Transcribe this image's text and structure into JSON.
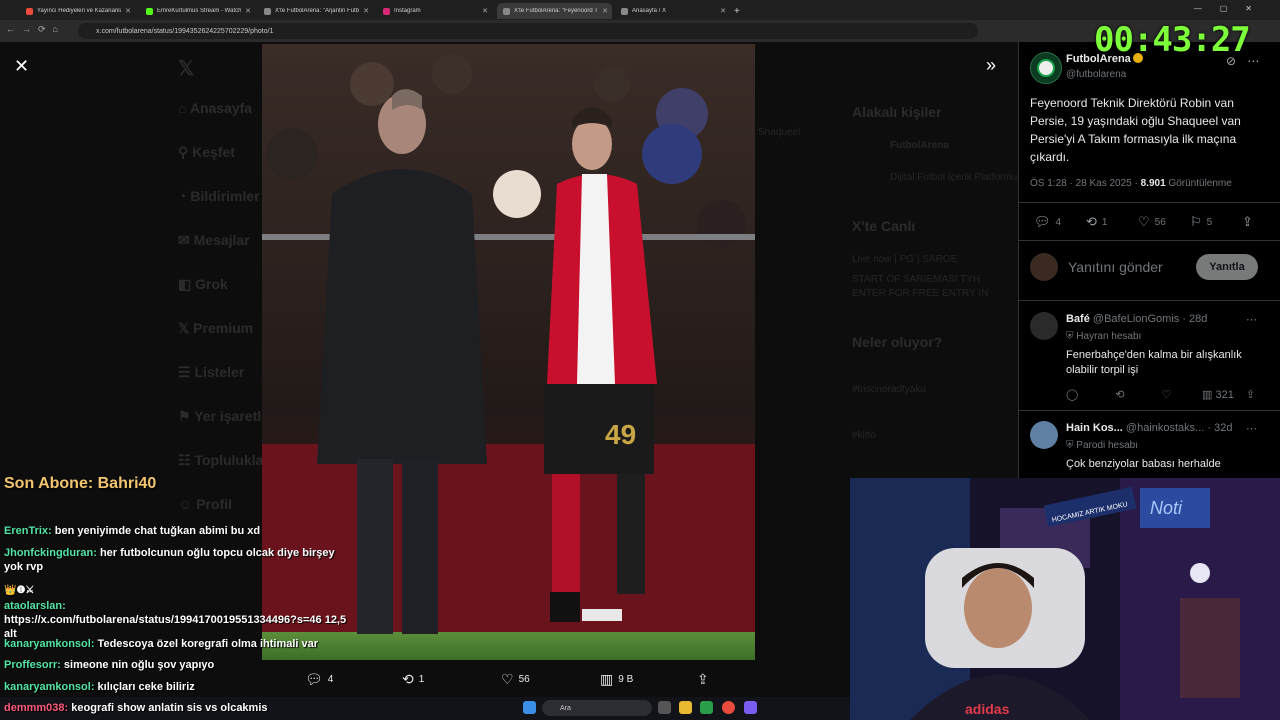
{
  "tabs": [
    {
      "label": "Yayıncı Hediyeleri ve Kazananlar",
      "color": "#e94b3c"
    },
    {
      "label": "EmreKurtulmus Stream - Watch",
      "color": "#53fc18"
    },
    {
      "label": "X'te FutbolArena: \"Arjantin Futb",
      "color": "#888888"
    },
    {
      "label": "Instagram",
      "color": "#d62976"
    },
    {
      "label": "X'te FutbolArena: \"Feyenoord T",
      "color": "#888888"
    },
    {
      "label": "Anasayfa / X",
      "color": "#888888"
    }
  ],
  "url": "x.com/futbolarena/status/1994352624225702229/photo/1",
  "timer": "00:43:27",
  "background_nav": [
    "Anasayfa",
    "Keşfet",
    "Bildirimler",
    "Mesajlar",
    "Grok",
    "Premium",
    "Listeler",
    "Yer işaretleri",
    "Topluluklar",
    "Profil"
  ],
  "background_right": {
    "who_to_follow": "Alakalı kişiler",
    "fa_name": "FutbolArena",
    "fa_desc": "Dijital Futbol İçerik Platformu",
    "live_title": "X'te Canlı",
    "live_line1": "Live now | PG | SARGE",
    "live_line2": "START OF SARIEMASI TYH",
    "live_line3": "ENTER FOR FREE ENTRY IN",
    "whats_happening": "Neler oluyor?",
    "trend1": "#trisonoradtyaku",
    "trend2": "#kitto",
    "shaqueel": "Shaqueel"
  },
  "photo_actions": {
    "reply": "4",
    "retweet": "1",
    "like": "56",
    "views": "9 B"
  },
  "tweet": {
    "display_name": "FutbolArena",
    "handle": "@futbolarena",
    "text": "Feyenoord Teknik Direktörü Robin van Persie, 19 yaşındaki oğlu Shaqueel van Persie'yi A Takım formasıyla ilk maçına çıkardı.",
    "time": "ÖS 1:28 · 28 Kas 2025 · ",
    "views": "8.901",
    "views_label": " Görüntülenme",
    "stats": {
      "reply": "4",
      "retweet": "1",
      "like": "56",
      "bookmark": "5"
    }
  },
  "reply_box": {
    "placeholder": "Yanıtını gönder",
    "button": "Yanıtla"
  },
  "replies": [
    {
      "name": "Bafé",
      "handle": "@BafeLionGomis · 28d",
      "badge": "Hayran hesabı",
      "text": "Fenerbahçe'den kalma bir alışkanlık olabilir torpil işi",
      "views": "321"
    },
    {
      "name": "Hain Kos...",
      "handle": "@hainkostaks... · 32d",
      "badge": "Parodi hesabı",
      "text": "Çok benziyolar babası herhalde"
    }
  ],
  "stream": {
    "last_sub_label": "Son Abone: Bahri40",
    "chat": [
      {
        "user": "ErenTrix:",
        "msg": "ben yeniyimde chat tuğkan abimi bu xd"
      },
      {
        "user": "Jhonfckingduran:",
        "msg": "her futbolcunun oğlu topcu olcak diye birşey yok rvp"
      },
      {
        "user": "ataolarslan:",
        "msg": "https://x.com/futbolarena/status/1994170019551334496?s=46 12,5 alt"
      },
      {
        "user": "kanaryamkonsol:",
        "msg": "Tedescoya özel koregrafi olma ihtimali var"
      },
      {
        "user": "Proffesorr:",
        "msg": "simeone nin oğlu şov yapıyo"
      },
      {
        "user": "kanaryamkonsol:",
        "msg": "kılıçları ceke biliriz"
      },
      {
        "user": "demmm038:",
        "msg": "keografi show anlatin sis vs olcakmis"
      }
    ],
    "cam_banner": "HOCAMIZ ARTIK MOKU",
    "shirt_text": "adidas"
  },
  "taskbar": {
    "search": "Ara"
  },
  "colors": {
    "timer": "#7dff3a",
    "sub_label": "#f3c570",
    "chat_user": "#53e4a3",
    "verified": "#e9b10b"
  }
}
